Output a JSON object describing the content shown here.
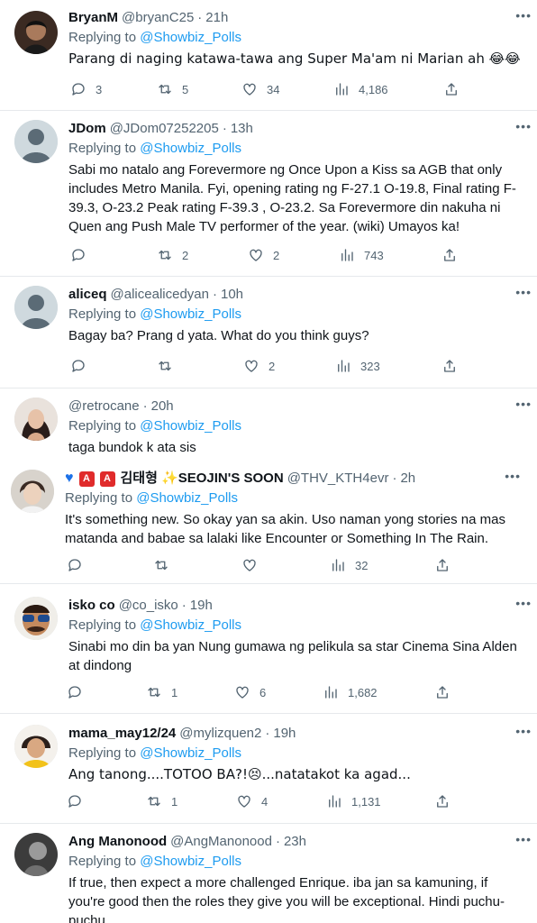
{
  "replying_label": "Replying to",
  "replying_mention": "@Showbiz_Polls",
  "tweets": [
    {
      "name": "BryanM",
      "handle": "@bryanC25",
      "time": "21h",
      "text": "Parang di naging katawa-tawa ang Super Ma'am ni Marian ah 😂😂",
      "replies": "3",
      "retweets": "5",
      "likes": "34",
      "views": "4,186"
    },
    {
      "name": "JDom",
      "handle": "@JDom07252205",
      "time": "13h",
      "text": "Sabi mo natalo ang Forevermore ng Once Upon a Kiss sa AGB that only includes Metro Manila. Fyi, opening rating ng F-27.1 O-19.8, Final rating F-39.3, O-23.2 Peak rating F-39.3 , O-23.2. Sa Forevermore din nakuha ni Quen ang Push Male TV performer of the year. (wiki) Umayos ka!",
      "replies": "",
      "retweets": "2",
      "likes": "2",
      "views": "743"
    },
    {
      "name": "aliceq",
      "handle": "@alicealicedyan",
      "time": "10h",
      "text": "Bagay ba? Prang d yata. What do you think guys?",
      "replies": "",
      "retweets": "",
      "likes": "2",
      "views": "323"
    },
    {
      "name": "",
      "handle": "@retrocane",
      "time": "20h",
      "text": "taga bundok k ata sis",
      "replies": "",
      "retweets": "",
      "likes": "",
      "views": ""
    },
    {
      "name": "김태형 ✨SEOJIN'S SOON",
      "handle": "@THV_KTH4evr",
      "time": "2h",
      "text": "It's something new. So okay yan sa akin. Uso naman yong stories na mas matanda and babae sa lalaki like Encounter or Something In The Rain.",
      "replies": "",
      "retweets": "",
      "likes": "",
      "views": "32",
      "badges": [
        "A",
        "A"
      ]
    },
    {
      "name": "isko co",
      "handle": "@co_isko",
      "time": "19h",
      "text": "Sinabi mo din ba yan Nung gumawa ng pelikula sa star Cinema Sina Alden at dindong",
      "replies": "",
      "retweets": "1",
      "likes": "6",
      "views": "1,682"
    },
    {
      "name": "mama_may12/24",
      "handle": "@mylizquen2",
      "time": "19h",
      "text": "Ang tanong....TOTOO BA?!😣...natatakot ka agad...",
      "replies": "",
      "retweets": "1",
      "likes": "4",
      "views": "1,131"
    },
    {
      "name": "Ang Manonood",
      "handle": "@AngManonood",
      "time": "23h",
      "text": "If true, then expect a more challenged Enrique. iba jan sa kamuning, if you're good then the roles they give you will be exceptional. Hindi puchu-puchu.",
      "replies": "",
      "retweets": "",
      "likes": "",
      "views": ""
    }
  ],
  "icons": [
    "reply-icon",
    "retweet-icon",
    "like-icon",
    "views-icon",
    "share-icon",
    "more-icon"
  ],
  "colors": {
    "link": "#1d9bf0",
    "secondary": "#536471",
    "primary_text": "#0f1419",
    "badge": "#e02b2b"
  }
}
